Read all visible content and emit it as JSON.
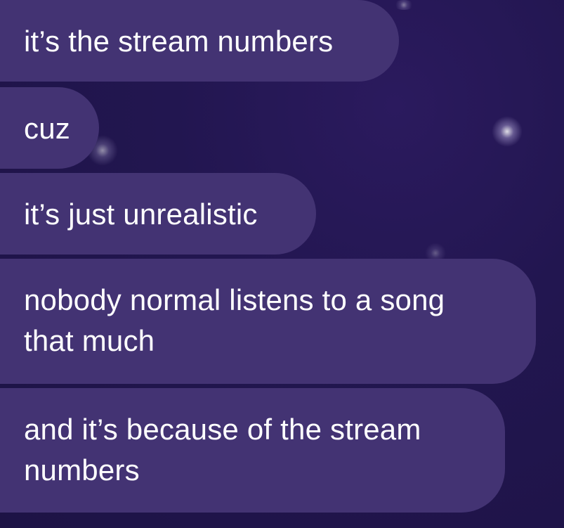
{
  "chat": {
    "messages": [
      {
        "text": "it’s the stream numbers"
      },
      {
        "text": "cuz"
      },
      {
        "text": "it’s just unrealistic"
      },
      {
        "text": "nobody normal listens to a song\nthat much"
      },
      {
        "text": "and it’s because of the stream\nnumbers"
      }
    ]
  },
  "colors": {
    "background": "#221650",
    "bubble": "#433373",
    "text": "#ffffff"
  }
}
